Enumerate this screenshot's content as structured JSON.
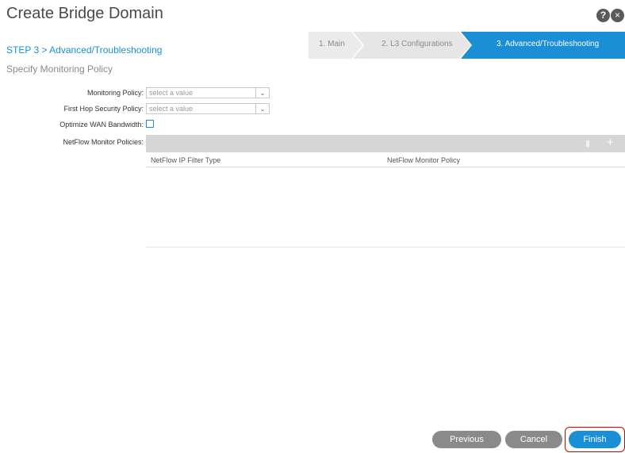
{
  "dialog": {
    "title": "Create Bridge Domain",
    "help_icon": "?",
    "close_icon": "×"
  },
  "wizard": {
    "steps": [
      {
        "label": "1. Main",
        "active": false
      },
      {
        "label": "2. L3 Configurations",
        "active": false
      },
      {
        "label": "3. Advanced/Troubleshooting",
        "active": true
      }
    ],
    "active_color": "#1a8fd6",
    "inactive_color": "#e8e8e8"
  },
  "step_heading": "STEP 3 > Advanced/Troubleshooting",
  "section_heading": "Specify Monitoring Policy",
  "form": {
    "monitoring_policy": {
      "label": "Monitoring Policy:",
      "value": "select a value"
    },
    "first_hop_security_policy": {
      "label": "First Hop Security Policy:",
      "value": "select a value"
    },
    "optimize_wan": {
      "label": "Optimize WAN Bandwidth:",
      "checked": false
    },
    "netflow": {
      "label": "NetFlow Monitor Policies:",
      "columns": [
        "NetFlow IP Filter Type",
        "NetFlow Monitor Policy"
      ],
      "rows": [],
      "trash_icon": "trash-icon",
      "add_icon": "+"
    }
  },
  "footer": {
    "previous": "Previous",
    "cancel": "Cancel",
    "finish": "Finish"
  }
}
